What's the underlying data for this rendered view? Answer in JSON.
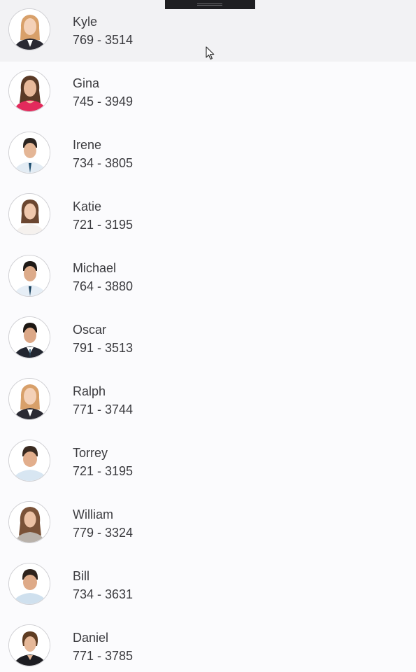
{
  "contacts": [
    {
      "name": "Kyle",
      "phone": "769 - 3514"
    },
    {
      "name": "Gina",
      "phone": "745 - 3949"
    },
    {
      "name": "Irene",
      "phone": "734 - 3805"
    },
    {
      "name": "Katie",
      "phone": "721 - 3195"
    },
    {
      "name": "Michael",
      "phone": "764 - 3880"
    },
    {
      "name": "Oscar",
      "phone": "791 - 3513"
    },
    {
      "name": "Ralph",
      "phone": "771 - 3744"
    },
    {
      "name": "Torrey",
      "phone": "721 - 3195"
    },
    {
      "name": "William",
      "phone": "779 - 3324"
    },
    {
      "name": "Bill",
      "phone": "734 - 3631"
    },
    {
      "name": "Daniel",
      "phone": "771 - 3785"
    }
  ],
  "icons": {
    "avatar": "person-avatar-icon",
    "cursor": "mouse-pointer-icon",
    "handle": "drag-handle-icon"
  }
}
